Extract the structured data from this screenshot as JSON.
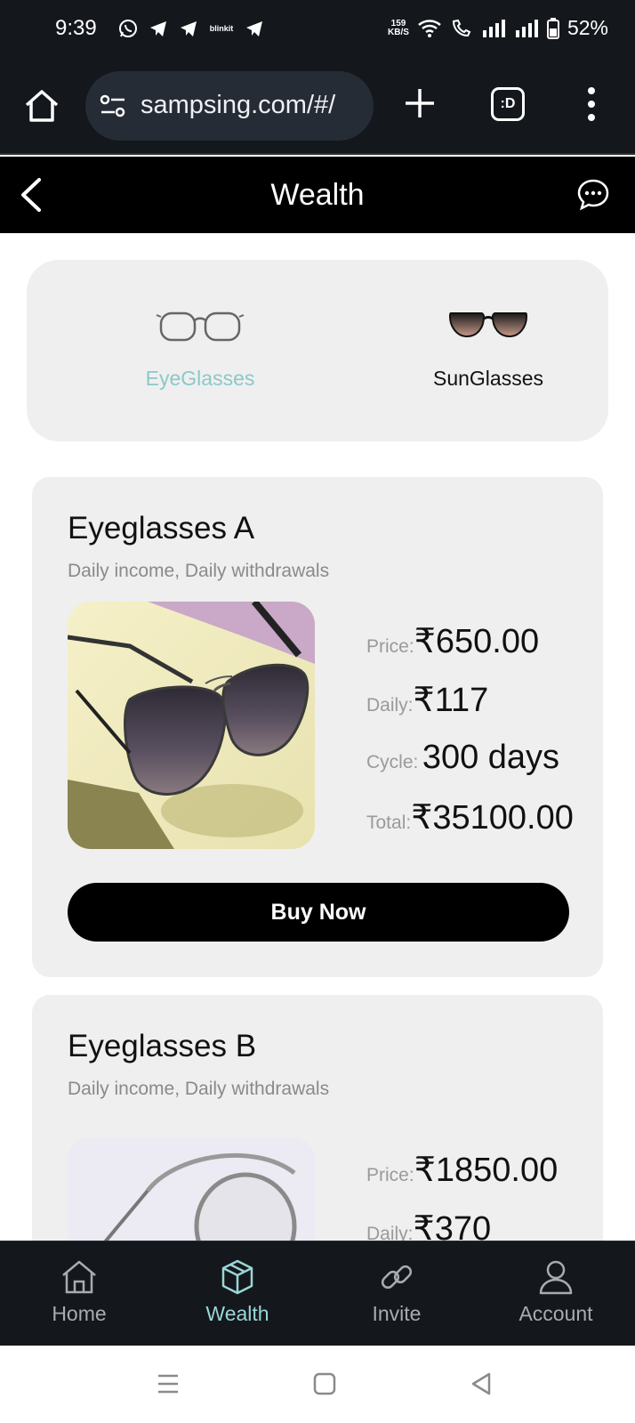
{
  "status_bar": {
    "time": "9:39",
    "notification_app": "blinkit",
    "net_speed_value": "159",
    "net_speed_unit": "KB/S",
    "battery": "52%"
  },
  "browser": {
    "url": "sampsing.com/#/",
    "tabs_label": ":D"
  },
  "header": {
    "title": "Wealth"
  },
  "categories": [
    {
      "label": "EyeGlasses",
      "active": true
    },
    {
      "label": "SunGlasses",
      "active": false
    }
  ],
  "products": [
    {
      "name": "Eyeglasses A",
      "subtitle": "Daily income, Daily withdrawals",
      "price_label": "Price:",
      "price": "₹650.00",
      "daily_label": "Daily:",
      "daily": "₹117",
      "cycle_label": "Cycle:",
      "cycle": "300 days",
      "total_label": "Total:",
      "total": "₹35100.00",
      "buy_label": "Buy Now"
    },
    {
      "name": "Eyeglasses B",
      "subtitle": "Daily income, Daily withdrawals",
      "price_label": "Price:",
      "price": "₹1850.00",
      "daily_label": "Daily:",
      "daily": "₹370"
    }
  ],
  "bottom_nav": [
    {
      "label": "Home",
      "icon": "home-icon",
      "active": false
    },
    {
      "label": "Wealth",
      "icon": "cube-icon",
      "active": true
    },
    {
      "label": "Invite",
      "icon": "link-icon",
      "active": false
    },
    {
      "label": "Account",
      "icon": "person-icon",
      "active": false
    }
  ],
  "colors": {
    "accent": "#9ad6d6",
    "dark_bar": "#14171c",
    "card_bg": "#efefef"
  }
}
